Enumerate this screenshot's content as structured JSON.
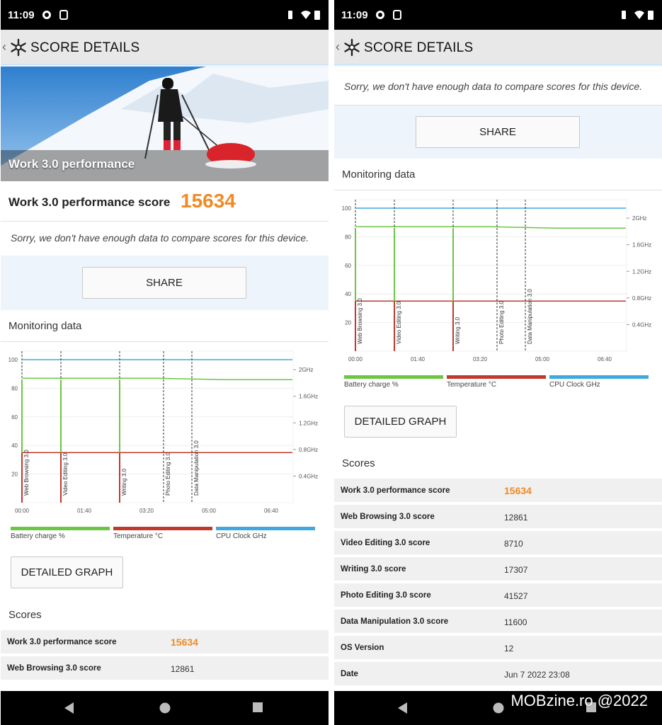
{
  "status": {
    "time": "11:09"
  },
  "header": {
    "title": "SCORE DETAILS"
  },
  "hero": {
    "label": "Work 3.0 performance",
    "label_suffix": "3.0"
  },
  "score": {
    "label": "Work 3.0 performance score",
    "value": "15634"
  },
  "compare_message": "Sorry, we don't have enough data to compare scores for this device.",
  "share_label": "SHARE",
  "monitoring": {
    "title": "Monitoring data",
    "y_ticks": [
      "100",
      "80",
      "60",
      "40",
      "20"
    ],
    "x_ticks": [
      "00:00",
      "01:40",
      "03:20",
      "05:00",
      "06:40"
    ],
    "right_ticks": [
      "2GHz",
      "1.6GHz",
      "1.2GHz",
      "0.8GHz",
      "0.4GHz"
    ],
    "markers": [
      "Web Browsing 3.0",
      "Video Editing 3.0",
      "Writing 3.0",
      "Photo Editing 3.0",
      "Data Manipulation 3.0"
    ],
    "legend": [
      {
        "label": "Battery charge %",
        "color": "#6cc644"
      },
      {
        "label": "Temperature °C",
        "color": "#c0392b"
      },
      {
        "label": "CPU Clock GHz",
        "color": "#3fa9dd"
      }
    ]
  },
  "chart_data": {
    "type": "line",
    "x": [
      "00:00",
      "01:40",
      "03:20",
      "05:00",
      "06:40"
    ],
    "ylim": [
      0,
      100
    ],
    "series": [
      {
        "name": "Battery charge %",
        "values": [
          87,
          87,
          87,
          86,
          86
        ]
      },
      {
        "name": "Temperature °C",
        "values": [
          35,
          35,
          35,
          35,
          35
        ]
      },
      {
        "name": "CPU Clock GHz",
        "values": [
          100,
          100,
          100,
          100,
          100
        ]
      }
    ]
  },
  "detailed_graph_label": "DETAILED GRAPH",
  "scores": {
    "title": "Scores",
    "rows": [
      {
        "label": "Work 3.0 performance score",
        "value": "15634"
      },
      {
        "label": "Web Browsing 3.0 score",
        "value": "12861"
      },
      {
        "label": "Video Editing 3.0 score",
        "value": "8710"
      },
      {
        "label": "Writing 3.0 score",
        "value": "17307"
      },
      {
        "label": "Photo Editing 3.0 score",
        "value": "41527"
      },
      {
        "label": "Data Manipulation 3.0 score",
        "value": "11600"
      },
      {
        "label": "OS Version",
        "value": "12"
      },
      {
        "label": "Date",
        "value": "Jun 7 2022 23:08"
      }
    ]
  },
  "watermark": "MOBzine.ro @2022"
}
